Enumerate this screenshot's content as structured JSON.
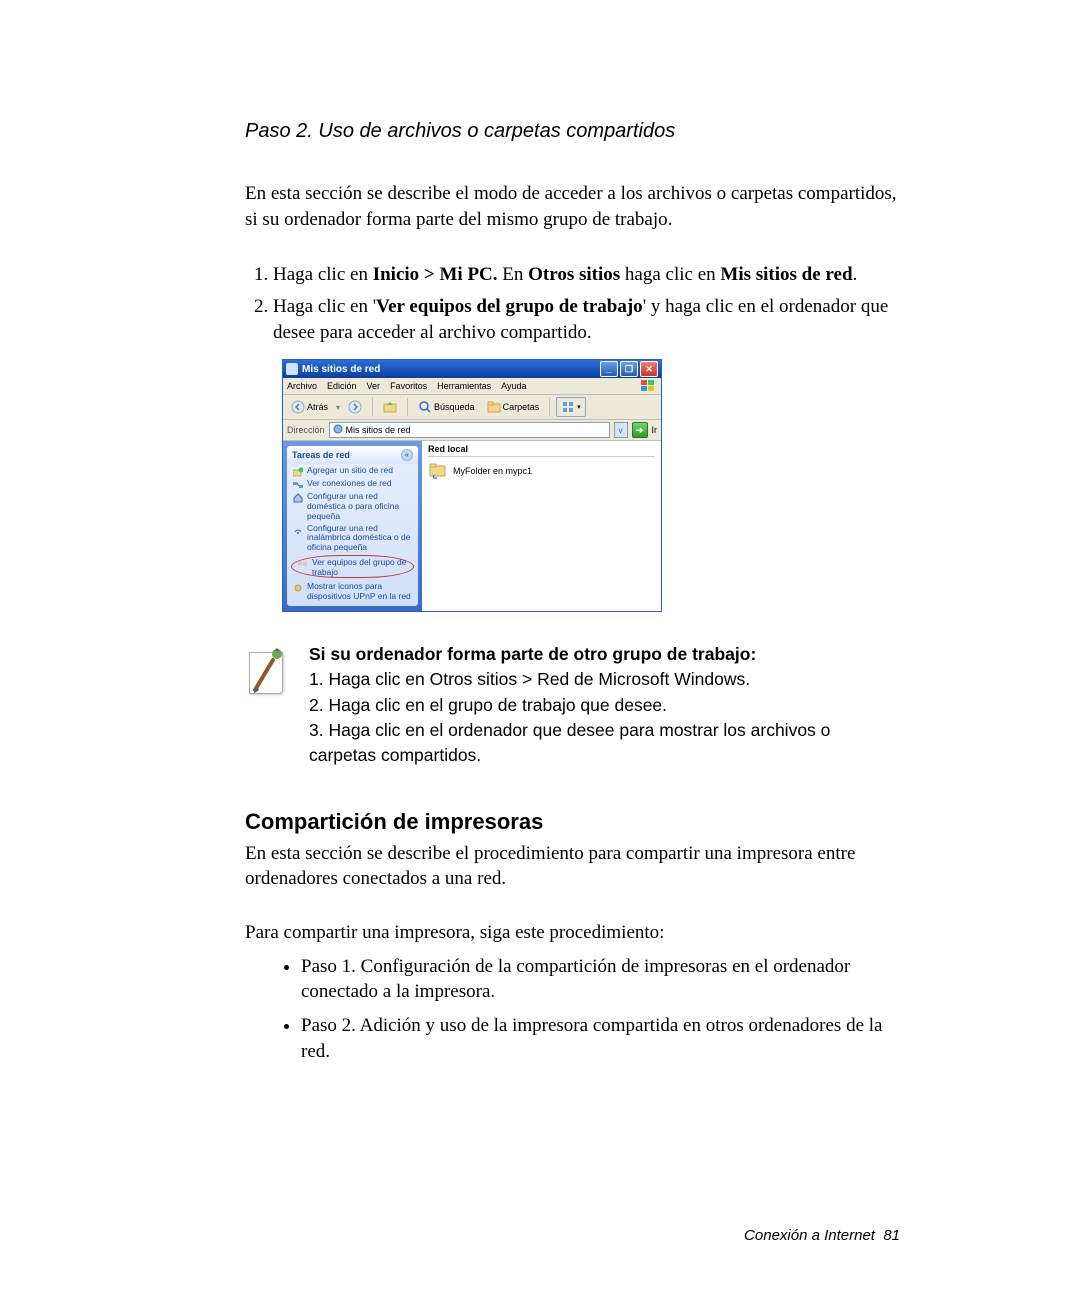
{
  "step_title": "Paso 2. Uso de archivos o carpetas compartidos",
  "intro": "En esta sección se describe el modo de acceder a los archivos o carpetas compartidos, si su ordenador forma parte del mismo grupo de trabajo.",
  "ol": {
    "i1a": "Haga clic en ",
    "i1b": "Inicio > Mi PC.",
    "i1c": " En ",
    "i1d": "Otros sitios",
    "i1e": " haga clic en ",
    "i1f": "Mis sitios de red",
    "i1g": ".",
    "i2a": "Haga clic en '",
    "i2b": "Ver equipos del grupo de trabajo",
    "i2c": "' y haga clic en el ordenador que desee para acceder al archivo compartido."
  },
  "xp": {
    "title": "Mis sitios de red",
    "menu": {
      "archivo": "Archivo",
      "edicion": "Edición",
      "ver": "Ver",
      "favoritos": "Favoritos",
      "herramientas": "Herramientas",
      "ayuda": "Ayuda"
    },
    "toolbar": {
      "atras": "Atrás",
      "busqueda": "Búsqueda",
      "carpetas": "Carpetas"
    },
    "address_label": "Dirección",
    "address_value": "Mis sitios de red",
    "go": "Ir",
    "dd": "v",
    "panel_head": "Tareas de red",
    "tasks": {
      "t1": "Agregar un sitio de red",
      "t2": "Ver conexiones de red",
      "t3": "Configurar una red doméstica o para oficina pequeña",
      "t4": "Configurar una red inalámbrica doméstica o de oficina pequeña",
      "t5": "Ver equipos del grupo de trabajo",
      "t6": "Mostrar iconos para dispositivos UPnP en la red"
    },
    "col_header": "Red local",
    "item": "MyFolder en mypc1",
    "btn_min": "_",
    "btn_max": "❐",
    "btn_close": "✕"
  },
  "note": {
    "head": "Si su ordenador forma parte de otro grupo de trabajo:",
    "l1": "1. Haga clic en Otros sitios > Red de Microsoft Windows.",
    "l2": "2. Haga clic en el grupo de trabajo que desee.",
    "l3": "3. Haga clic en el ordenador que desee para mostrar los archivos o carpetas compartidos."
  },
  "section2": {
    "title": "Compartición de impresoras",
    "p1": "En esta sección se describe el procedimiento para compartir una impresora entre ordenadores conectados a una red.",
    "p2": "Para compartir una impresora, siga este procedimiento:",
    "b1": "Paso 1. Configuración de la compartición de impresoras en el ordenador conectado a la impresora.",
    "b2": "Paso 2. Adición y uso de la impresora compartida en otros ordenadores de la red."
  },
  "footer": {
    "label": "Conexión a Internet",
    "page": "81"
  }
}
